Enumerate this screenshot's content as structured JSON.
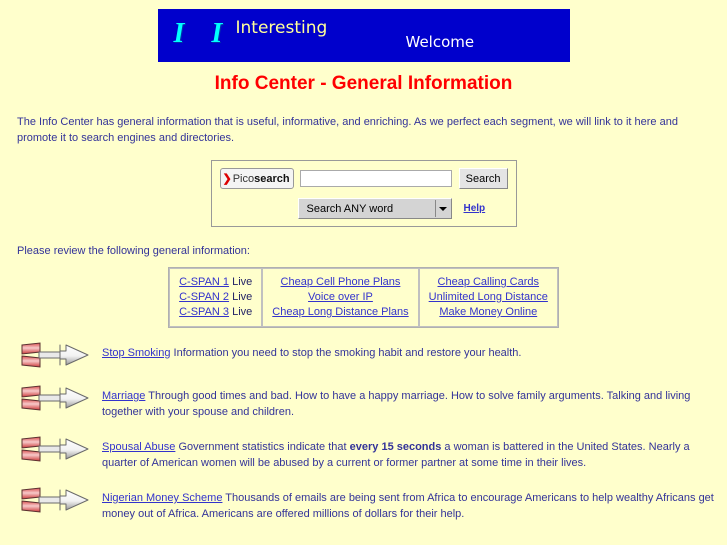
{
  "banner": {
    "logo_letters": "I I",
    "logo_word": "Interesting",
    "welcome": "Welcome"
  },
  "page_title": "Info Center - General Information",
  "intro": "The Info Center has general information that is useful, informative, and enriching. As we perfect each segment, we will link to it here and promote it to search engines and directories.",
  "search": {
    "logo_arrow": "❯",
    "logo_pico": "Pico",
    "logo_search": "search",
    "input_value": "",
    "input_placeholder": "",
    "button_label": "Search",
    "select_value": "Search ANY word",
    "help_label": "Help"
  },
  "please_review": "Please review the following general information:",
  "links_table": {
    "columns": [
      {
        "rows": [
          {
            "link": "C-SPAN 1",
            "suffix": " Live"
          },
          {
            "link": "C-SPAN 2",
            "suffix": " Live"
          },
          {
            "link": "C-SPAN 3",
            "suffix": " Live"
          }
        ]
      },
      {
        "rows": [
          {
            "link": "Cheap Cell Phone Plans",
            "suffix": ""
          },
          {
            "link": "Voice over IP",
            "suffix": ""
          },
          {
            "link": "Cheap Long Distance Plans",
            "suffix": ""
          }
        ]
      },
      {
        "rows": [
          {
            "link": "Cheap Calling Cards",
            "suffix": ""
          },
          {
            "link": "Unlimited Long Distance",
            "suffix": ""
          },
          {
            "link": "Make Money Online",
            "suffix": ""
          }
        ]
      }
    ]
  },
  "items": [
    {
      "icon": "arrow-right-icon",
      "link": "Stop Smoking",
      "text_before_bold": " Information you need to stop the smoking habit and restore your health.",
      "bold": "",
      "text_after_bold": ""
    },
    {
      "icon": "arrow-right-icon",
      "link": "Marriage",
      "text_before_bold": " Through good times and bad. How to have a happy marriage. How to solve family arguments. Talking and living together with your spouse and children.",
      "bold": "",
      "text_after_bold": ""
    },
    {
      "icon": "arrow-right-icon",
      "link": "Spousal Abuse",
      "text_before_bold": " Government statistics indicate that ",
      "bold": "every 15 seconds",
      "text_after_bold": " a woman is battered in the United States. Nearly a quarter of American women will be abused by a current or former partner at some time in their lives."
    },
    {
      "icon": "arrow-right-icon",
      "link": "Nigerian Money Scheme",
      "text_before_bold": " Thousands of emails are being sent from Africa to encourage Americans to help wealthy Africans get money out of Africa. Americans are offered millions of dollars for their help.",
      "bold": "",
      "text_after_bold": ""
    }
  ],
  "colors": {
    "page_background": "#ffffcc",
    "banner_background": "#0000cc",
    "logo_letters": "#00ffff",
    "logo_word": "#ffff99",
    "title_red": "#ff0000",
    "body_text": "#333399",
    "link_blue": "#3333cc"
  }
}
